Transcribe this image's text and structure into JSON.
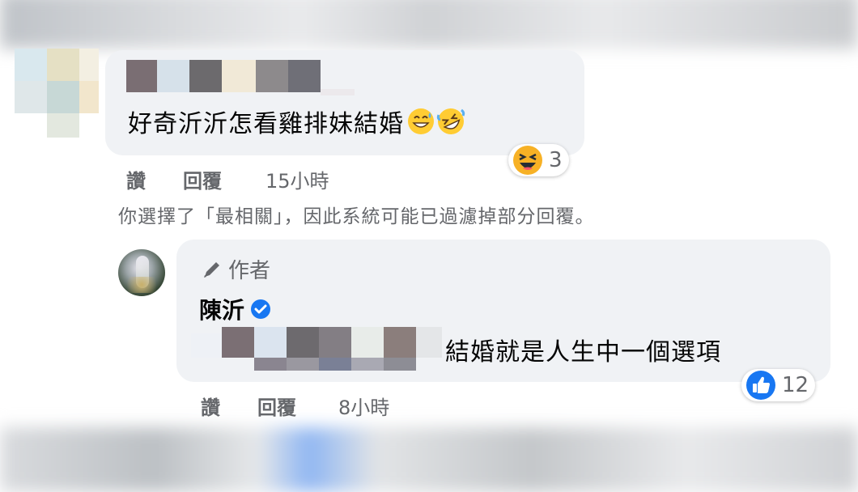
{
  "comment1": {
    "text": "好奇沂沂怎看雞排妹結婚",
    "emojis": [
      "grinning-sweat-emoji",
      "rofl-emoji"
    ],
    "reaction": {
      "icon": "haha-reaction-icon",
      "count": "3"
    },
    "actions": {
      "like": "讚",
      "reply": "回覆",
      "time": "15小時"
    }
  },
  "filter_note": "你選擇了「最相關」，因此系統可能已過濾掉部分回覆。",
  "reply1": {
    "author_tag": "作者",
    "author_name": "陳沂",
    "verified_icon": "verified-badge-icon",
    "text": "結婚就是人生中一個選項",
    "reaction": {
      "icon": "like-reaction-icon",
      "count": "12"
    },
    "actions": {
      "like": "讚",
      "reply": "回覆",
      "time": "8小時"
    }
  },
  "colors": {
    "bubble": "#f0f2f5",
    "meta": "#65676b",
    "like_blue": "#1877f2",
    "verified_blue": "#1877f2"
  }
}
